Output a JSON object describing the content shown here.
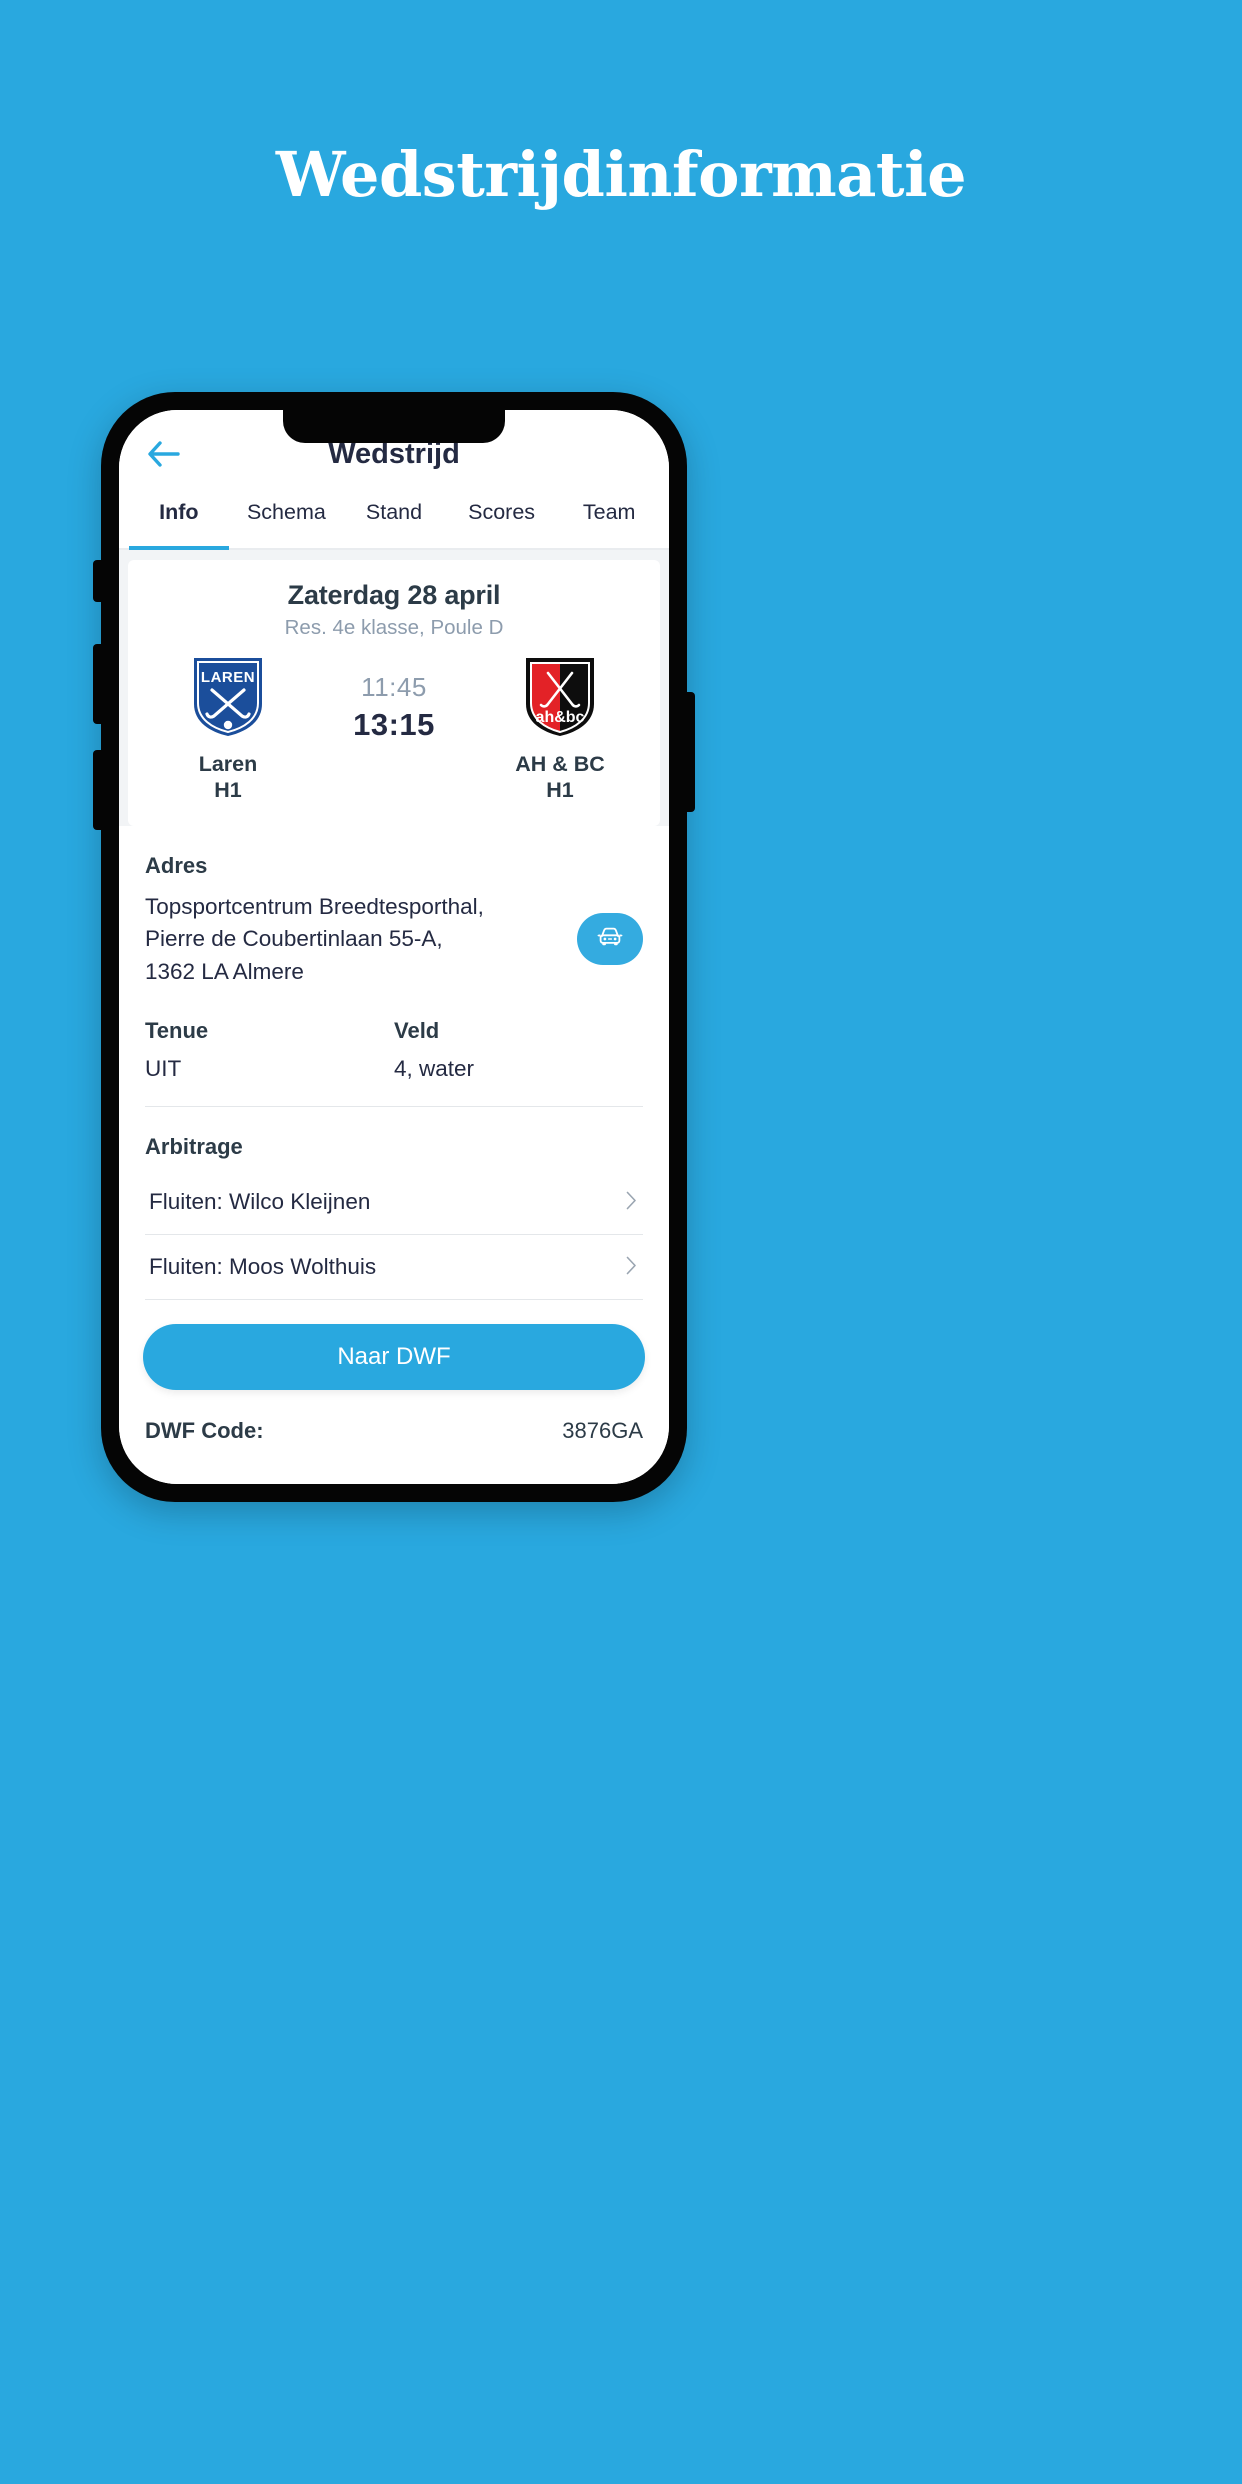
{
  "page": {
    "heading": "Wedstrijdinformatie",
    "background_color": "#29A8DF"
  },
  "app": {
    "header": {
      "back_icon": "arrow-left-icon",
      "title": "Wedstrijd"
    },
    "tabs": [
      {
        "label": "Info",
        "active": true
      },
      {
        "label": "Schema",
        "active": false
      },
      {
        "label": "Stand",
        "active": false
      },
      {
        "label": "Scores",
        "active": false
      },
      {
        "label": "Team",
        "active": false
      }
    ],
    "match_card": {
      "date": "Zaterdag 28 april",
      "competition": "Res. 4e klasse, Poule D",
      "home": {
        "crest": "laren-shield-crest",
        "crest_text": "LAREN",
        "name": "Laren",
        "team": "H1"
      },
      "away": {
        "crest": "ahbc-shield-crest",
        "crest_text": "ah&bc",
        "name": "AH & BC",
        "team": "H1"
      },
      "time_planned": "11:45",
      "time_actual": "13:15"
    },
    "address": {
      "title": "Adres",
      "lines": [
        "Topsportcentrum Breedtesporthal,",
        "Pierre de Coubertinlaan 55-A,",
        "1362 LA Almere"
      ],
      "route_button_icon": "car-icon"
    },
    "details": {
      "tenue_label": "Tenue",
      "tenue_value": "UIT",
      "veld_label": "Veld",
      "veld_value": "4, water"
    },
    "officials": {
      "title": "Arbitrage",
      "rows": [
        {
          "label": "Fluiten: Wilco Kleijnen",
          "chevron": "chevron-right-icon"
        },
        {
          "label": "Fluiten: Moos Wolthuis",
          "chevron": "chevron-right-icon"
        }
      ]
    },
    "cta": {
      "label": "Naar DWF"
    },
    "dwf": {
      "label": "DWF Code:",
      "code": "3876GA"
    }
  },
  "colors": {
    "accent": "#29A8DF",
    "dark_text": "#242a42",
    "muted_text": "#8d9cad",
    "crest_blue": "#1B4E9B",
    "crest_red": "#E32227",
    "crest_black": "#0D0D0D"
  }
}
